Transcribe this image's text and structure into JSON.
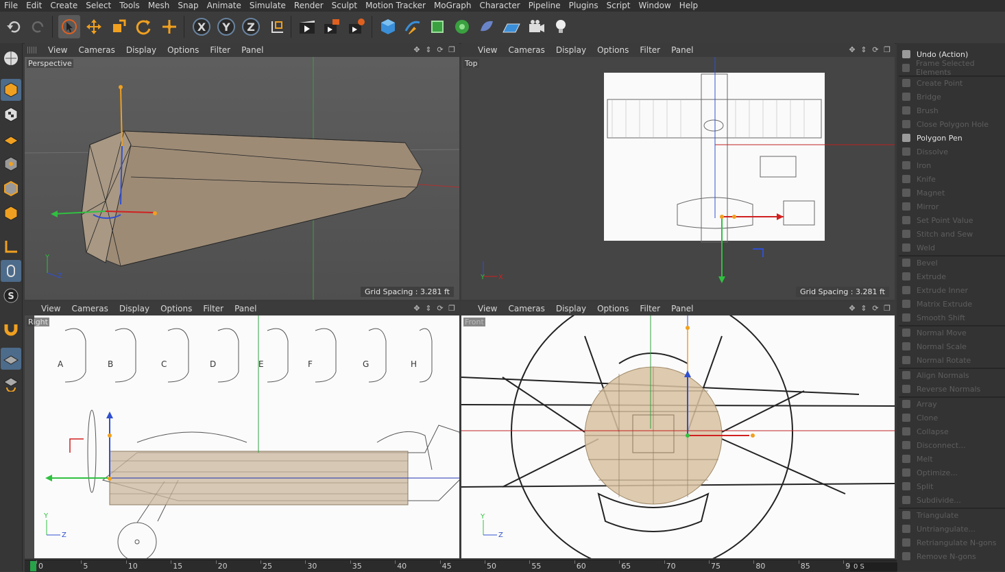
{
  "menu": [
    "File",
    "Edit",
    "Create",
    "Select",
    "Tools",
    "Mesh",
    "Snap",
    "Animate",
    "Simulate",
    "Render",
    "Sculpt",
    "Motion Tracker",
    "MoGraph",
    "Character",
    "Pipeline",
    "Plugins",
    "Script",
    "Window",
    "Help"
  ],
  "toolbar": {
    "undo_icon": "undo-icon",
    "redo_icon": "redo-icon",
    "select_icon": "live-selection-icon",
    "move_icon": "move-icon",
    "scale_icon": "scale-icon",
    "rotate_icon": "rotate-icon",
    "axis_x": "X",
    "axis_y": "Y",
    "axis_z": "Z"
  },
  "viewport_menu": [
    "View",
    "Cameras",
    "Display",
    "Options",
    "Filter",
    "Panel"
  ],
  "viewports": {
    "perspective": {
      "name": "Perspective",
      "grid": "Grid Spacing : 3.281 ft",
      "axis_y": "Y",
      "axis_z": "Z"
    },
    "top": {
      "name": "Top",
      "grid": "Grid Spacing : 3.281 ft",
      "axis_y": "Y",
      "axis_x": "X"
    },
    "right": {
      "name": "Right",
      "axis_y": "Y",
      "axis_z": "Z",
      "letters": [
        "A",
        "B",
        "C",
        "D",
        "E",
        "F",
        "G",
        "H"
      ]
    },
    "front": {
      "name": "Front",
      "axis_y": "Y",
      "axis_z": "Z"
    }
  },
  "right_panel": {
    "items": [
      {
        "label": "Undo (Action)",
        "on": true
      },
      {
        "label": "Frame Selected Elements",
        "on": false
      },
      {
        "sep": true
      },
      {
        "label": "Create Point",
        "on": false
      },
      {
        "label": "Bridge",
        "on": false
      },
      {
        "label": "Brush",
        "on": false
      },
      {
        "label": "Close Polygon Hole",
        "on": false
      },
      {
        "label": "Polygon Pen",
        "on": true
      },
      {
        "label": "Dissolve",
        "on": false
      },
      {
        "label": "Iron",
        "on": false
      },
      {
        "label": "Knife",
        "on": false
      },
      {
        "label": "Magnet",
        "on": false
      },
      {
        "label": "Mirror",
        "on": false
      },
      {
        "label": "Set Point Value",
        "on": false
      },
      {
        "label": "Stitch and Sew",
        "on": false
      },
      {
        "label": "Weld",
        "on": false
      },
      {
        "sep": true
      },
      {
        "label": "Bevel",
        "on": false
      },
      {
        "label": "Extrude",
        "on": false
      },
      {
        "label": "Extrude Inner",
        "on": false
      },
      {
        "label": "Matrix Extrude",
        "on": false
      },
      {
        "label": "Smooth Shift",
        "on": false
      },
      {
        "sep": true
      },
      {
        "label": "Normal Move",
        "on": false
      },
      {
        "label": "Normal Scale",
        "on": false
      },
      {
        "label": "Normal Rotate",
        "on": false
      },
      {
        "sep": true
      },
      {
        "label": "Align Normals",
        "on": false
      },
      {
        "label": "Reverse Normals",
        "on": false
      },
      {
        "sep": true
      },
      {
        "label": "Array",
        "on": false
      },
      {
        "label": "Clone",
        "on": false
      },
      {
        "label": "Collapse",
        "on": false
      },
      {
        "label": "Disconnect...",
        "on": false
      },
      {
        "label": "Melt",
        "on": false
      },
      {
        "label": "Optimize...",
        "on": false
      },
      {
        "label": "Split",
        "on": false
      },
      {
        "label": "Subdivide...",
        "on": false
      },
      {
        "sep": true
      },
      {
        "label": "Triangulate",
        "on": false
      },
      {
        "label": "Untriangulate...",
        "on": false
      },
      {
        "label": "Retriangulate N-gons",
        "on": false
      },
      {
        "label": "Remove N-gons",
        "on": false
      }
    ]
  },
  "timeline": {
    "ticks": [
      "0",
      "5",
      "10",
      "15",
      "20",
      "25",
      "30",
      "35",
      "40",
      "45",
      "50",
      "55",
      "60",
      "65",
      "70",
      "75",
      "80",
      "85",
      "90"
    ],
    "current": "0 S"
  }
}
